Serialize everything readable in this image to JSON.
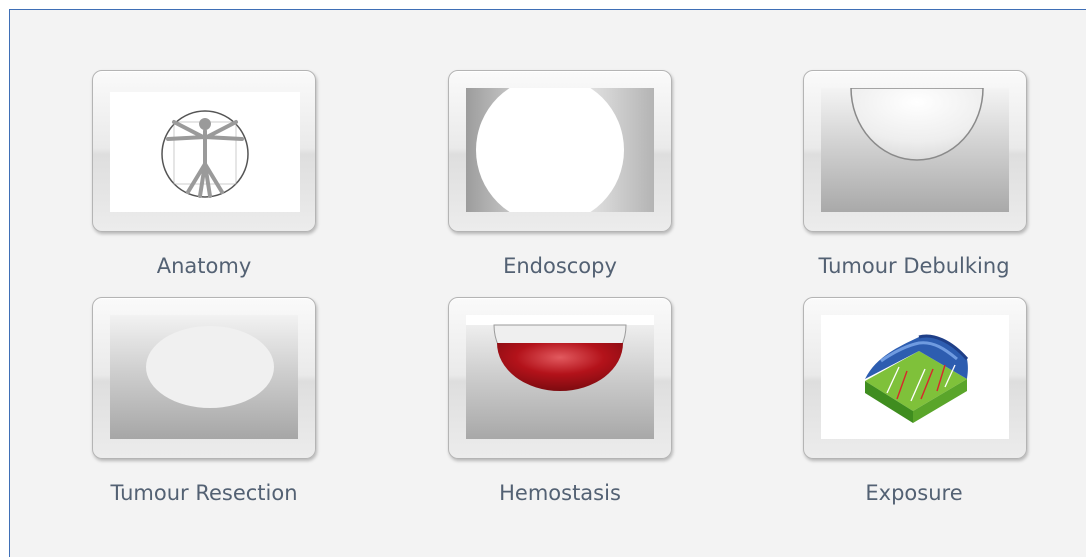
{
  "tiles": [
    {
      "label": "Anatomy",
      "icon": "vitruvian-man-icon"
    },
    {
      "label": "Endoscopy",
      "icon": "endoscope-view-icon"
    },
    {
      "label": "Tumour Debulking",
      "icon": "debulking-cavity-icon"
    },
    {
      "label": "Tumour Resection",
      "icon": "resection-oval-icon"
    },
    {
      "label": "Hemostasis",
      "icon": "blood-pool-icon"
    },
    {
      "label": "Exposure",
      "icon": "tissue-exposure-icon"
    }
  ],
  "colors": {
    "panel_border": "#3f6fb6",
    "label_text": "#536173",
    "blood_red": "#b3121a"
  }
}
